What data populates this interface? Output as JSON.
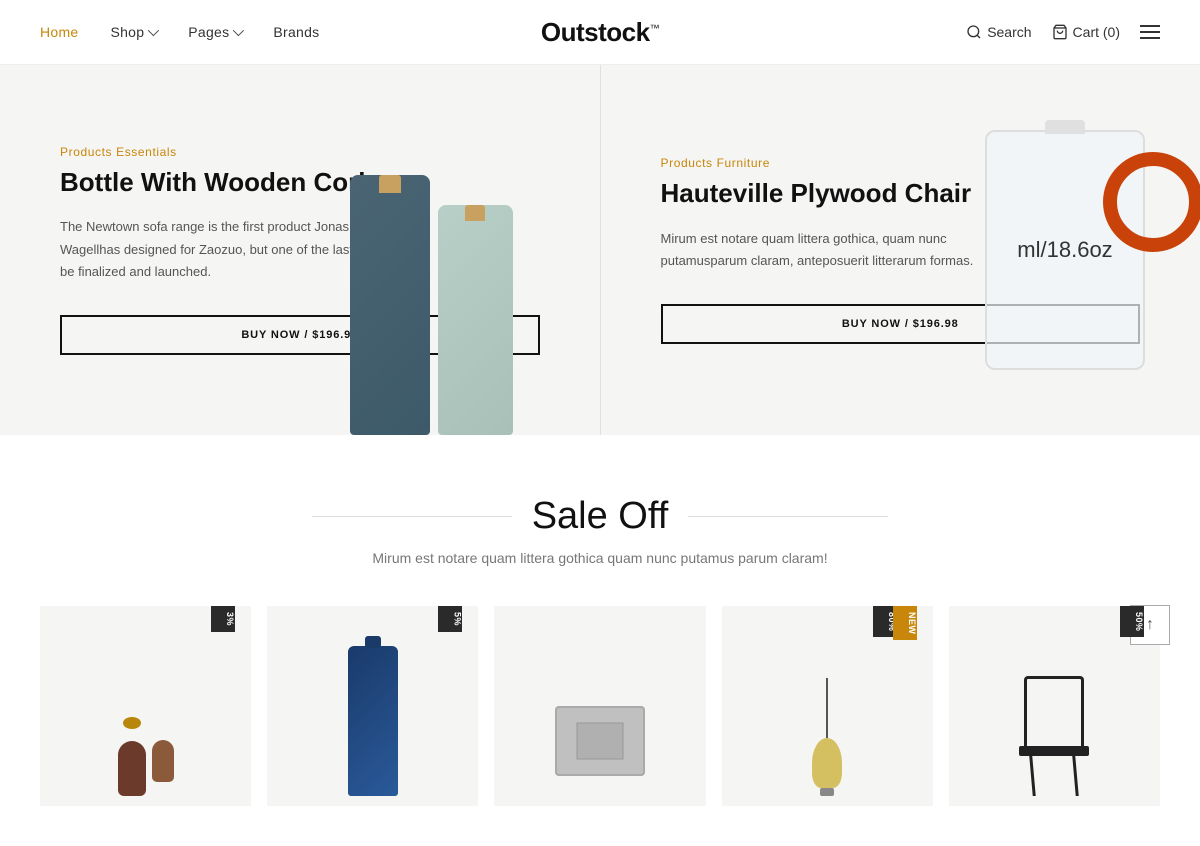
{
  "nav": {
    "logo": "Outstock",
    "logo_sup": "™",
    "links": [
      {
        "id": "home",
        "label": "Home",
        "active": true
      },
      {
        "id": "shop",
        "label": "Shop",
        "has_chevron": true
      },
      {
        "id": "pages",
        "label": "Pages",
        "has_chevron": true
      },
      {
        "id": "brands",
        "label": "Brands",
        "has_chevron": false
      }
    ],
    "search_label": "Search",
    "cart_label": "Cart (0)",
    "menu_label": "Menu"
  },
  "hero": {
    "panel1": {
      "category": "Products Essentials",
      "title": "Bottle With Wooden Cork",
      "description": "The Newtown sofa range is the first product Jonas Wagellhas designed for Zaozuo, but one of the last to be finalized and launched.",
      "btn_label": "BUY NOW / $196.98"
    },
    "panel2": {
      "category": "Products Furniture",
      "title": "Hauteville Plywood Chair",
      "description": "Mirum est notare quam littera gothica, quam nunc putamusparum claram, anteposuerit litterarum formas.",
      "btn_label": "BUY NOW / $196.98",
      "jug_text": "ml/18.6oz"
    }
  },
  "sale": {
    "title": "Sale Off",
    "subtitle": "Mirum est notare quam littera gothica quam nunc putamus parum claram!",
    "products": [
      {
        "id": "p1",
        "badge": "3%",
        "badge_type": "dark"
      },
      {
        "id": "p2",
        "badge": "5%",
        "badge_type": "dark"
      },
      {
        "id": "p3",
        "badge": "",
        "badge_type": ""
      },
      {
        "id": "p4",
        "badge": "80%",
        "badge_type": "dark",
        "badge2": "NEW",
        "badge2_type": "gold"
      },
      {
        "id": "p5",
        "badge": "50%",
        "badge_type": "dark"
      }
    ]
  },
  "scroll_top": "↑"
}
